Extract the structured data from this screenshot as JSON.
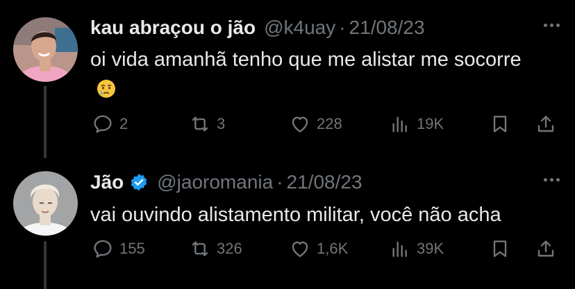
{
  "tweets": [
    {
      "display_name": "kau abraçou o jão",
      "handle": "@k4uay",
      "separator": "·",
      "date": "21/08/23",
      "text": "oi vida amanhã tenho que me alistar me socorre",
      "emoji_name": "crying-face-emoji",
      "verified": false,
      "replies": "2",
      "retweets": "3",
      "likes": "228",
      "views": "19K",
      "avatar_colors": {
        "bg": "#c9a394",
        "skin": "#d8a88e",
        "hair": "#2a1d18",
        "shirt": "#f0a6c2"
      }
    },
    {
      "display_name": "Jão",
      "handle": "@jaoromania",
      "separator": "·",
      "date": "21/08/23",
      "text": "vai ouvindo alistamento militar, você não acha",
      "verified": true,
      "replies": "155",
      "retweets": "326",
      "likes": "1,6K",
      "views": "39K",
      "avatar_colors": {
        "bg": "#a2a4a6",
        "skin": "#e9dacb",
        "hair": "#f3ece0",
        "shirt": "#f5f5f5"
      }
    }
  ],
  "colors": {
    "background": "#000000",
    "primary_text": "#e7e9ea",
    "secondary_text": "#71767b",
    "thread_line": "#333639",
    "verified_badge": "#1d9bf0"
  },
  "icons": {
    "reply": "speech-bubble-icon",
    "retweet": "retweet-arrows-icon",
    "like": "heart-icon",
    "views": "bar-chart-icon",
    "bookmark": "bookmark-icon",
    "share": "share-upload-icon",
    "more": "more-horizontal-icon",
    "verified": "verified-badge-icon"
  }
}
